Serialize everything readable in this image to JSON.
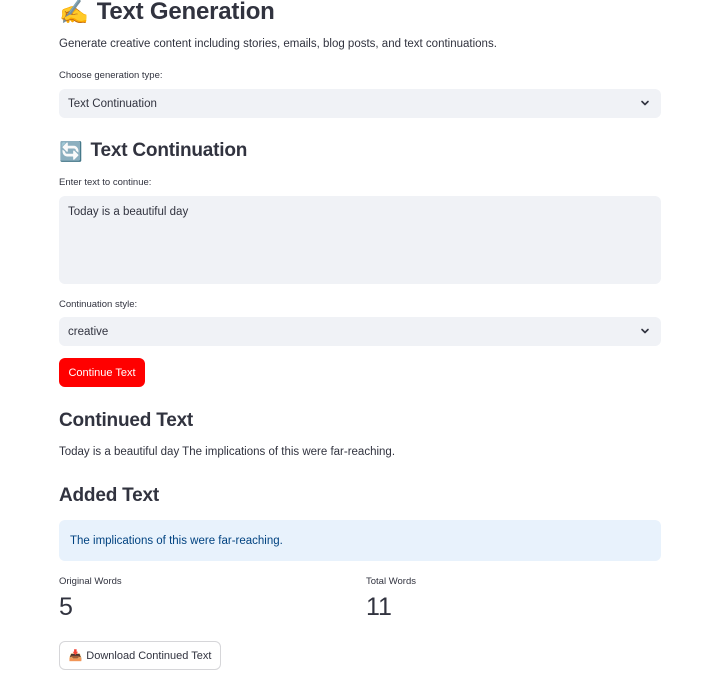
{
  "page": {
    "title": "Text Generation",
    "title_icon": "✍️",
    "description": "Generate creative content including stories, emails, blog posts, and text continuations."
  },
  "generation_type": {
    "label": "Choose generation type:",
    "value": "Text Continuation"
  },
  "section": {
    "title": "Text Continuation",
    "icon": "🔄"
  },
  "input_text": {
    "label": "Enter text to continue:",
    "value": "Today is a beautiful day"
  },
  "continuation_style": {
    "label": "Continuation style:",
    "value": "creative"
  },
  "continue_button": {
    "label": "Continue Text"
  },
  "continued": {
    "title": "Continued Text",
    "text": "Today is a beautiful day The implications of this were far-reaching."
  },
  "added": {
    "title": "Added Text",
    "text": "The implications of this were far-reaching."
  },
  "metrics": {
    "original_label": "Original Words",
    "original_value": "5",
    "total_label": "Total Words",
    "total_value": "11"
  },
  "download_button": {
    "icon": "📥",
    "label": "Download Continued Text"
  },
  "colors": {
    "primary_button": "#ff0000",
    "info_background": "#e8f2fc",
    "info_text": "#004280",
    "input_background": "#f0f2f6",
    "text": "#31333f"
  }
}
